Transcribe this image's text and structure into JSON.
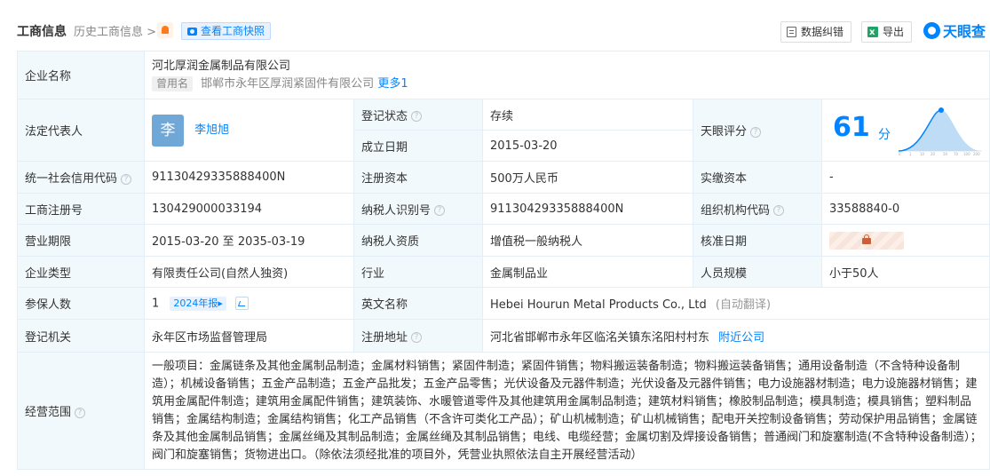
{
  "header": {
    "title": "工商信息",
    "history_link": "历史工商信息 >",
    "snapshot_button": "查看工商快照",
    "data_correction_button": "数据纠错",
    "export_button": "导出",
    "logo_text": "天眼查",
    "accent_color": "#0084ff"
  },
  "company": {
    "name_label": "企业名称",
    "name": "河北厚润金属制品有限公司",
    "alias_tag": "曾用名",
    "alias": "邯郸市永年区厚润紧固件有限公司",
    "alias_more": "更多1"
  },
  "legal_rep": {
    "label": "法定代表人",
    "avatar_char": "李",
    "name": "李旭旭"
  },
  "status": {
    "label": "登记状态",
    "value": "存续"
  },
  "founded": {
    "label": "成立日期",
    "value": "2015-03-20"
  },
  "score": {
    "label": "天眼评分",
    "value": "61",
    "unit": "分",
    "curve_axis": [
      "0",
      "1",
      "10",
      "20",
      "50",
      "70",
      "100",
      "200"
    ]
  },
  "credit_code": {
    "label": "统一社会信用代码",
    "value": "91130429335888400N"
  },
  "reg_capital": {
    "label": "注册资本",
    "value": "500万人民币"
  },
  "paid_capital": {
    "label": "实缴资本",
    "value": "-"
  },
  "reg_no": {
    "label": "工商注册号",
    "value": "130429000033194"
  },
  "taxpayer_id": {
    "label": "纳税人识别号",
    "value": "91130429335888400N"
  },
  "org_code": {
    "label": "组织机构代码",
    "value": "33588840-0"
  },
  "business_term": {
    "label": "营业期限",
    "value": "2015-03-20 至 2035-03-19"
  },
  "taxpayer_qual": {
    "label": "纳税人资质",
    "value": "增值税一般纳税人"
  },
  "approval_date": {
    "label": "核准日期"
  },
  "company_type": {
    "label": "企业类型",
    "value": "有限责任公司(自然人独资)"
  },
  "industry": {
    "label": "行业",
    "value": "金属制品业"
  },
  "staff_size": {
    "label": "人员规模",
    "value": "小于50人"
  },
  "insured": {
    "label": "参保人数",
    "value": "1",
    "year_tag": "2024年报"
  },
  "english_name": {
    "label": "英文名称",
    "value": "Hebei Hourun Metal Products Co., Ltd",
    "note": "(自动翻译)"
  },
  "registry": {
    "label": "登记机关",
    "value": "永年区市场监督管理局"
  },
  "address": {
    "label": "注册地址",
    "value": "河北省邯郸市永年区临洺关镇东洺阳村村东",
    "nearby_link": "附近公司"
  },
  "scope": {
    "label": "经营范围",
    "value": "一般项目：金属链条及其他金属制品制造；金属材料销售；紧固件制造；紧固件销售；物料搬运装备制造；物料搬运装备销售；通用设备制造（不含特种设备制造）；机械设备销售；五金产品制造；五金产品批发；五金产品零售；光伏设备及元器件制造；光伏设备及元器件销售；电力设施器材制造；电力设施器材销售；建筑用金属配件制造；建筑用金属配件销售；建筑装饰、水暖管道零件及其他建筑用金属制品制造；建筑材料销售；橡胶制品制造；模具制造；模具销售；塑料制品销售；金属结构制造；金属结构销售；化工产品销售（不含许可类化工产品）；矿山机械制造；矿山机械销售；配电开关控制设备销售；劳动保护用品销售；金属链条及其他金属制品销售；金属丝绳及其制品制造；金属丝绳及其制品销售；电线、电缆经营；金属切割及焊接设备销售；普通阀门和旋塞制造(不含特种设备制造）；阀门和旋塞销售；货物进出口。（除依法须经批准的项目外，凭营业执照依法自主开展经营活动）"
  }
}
